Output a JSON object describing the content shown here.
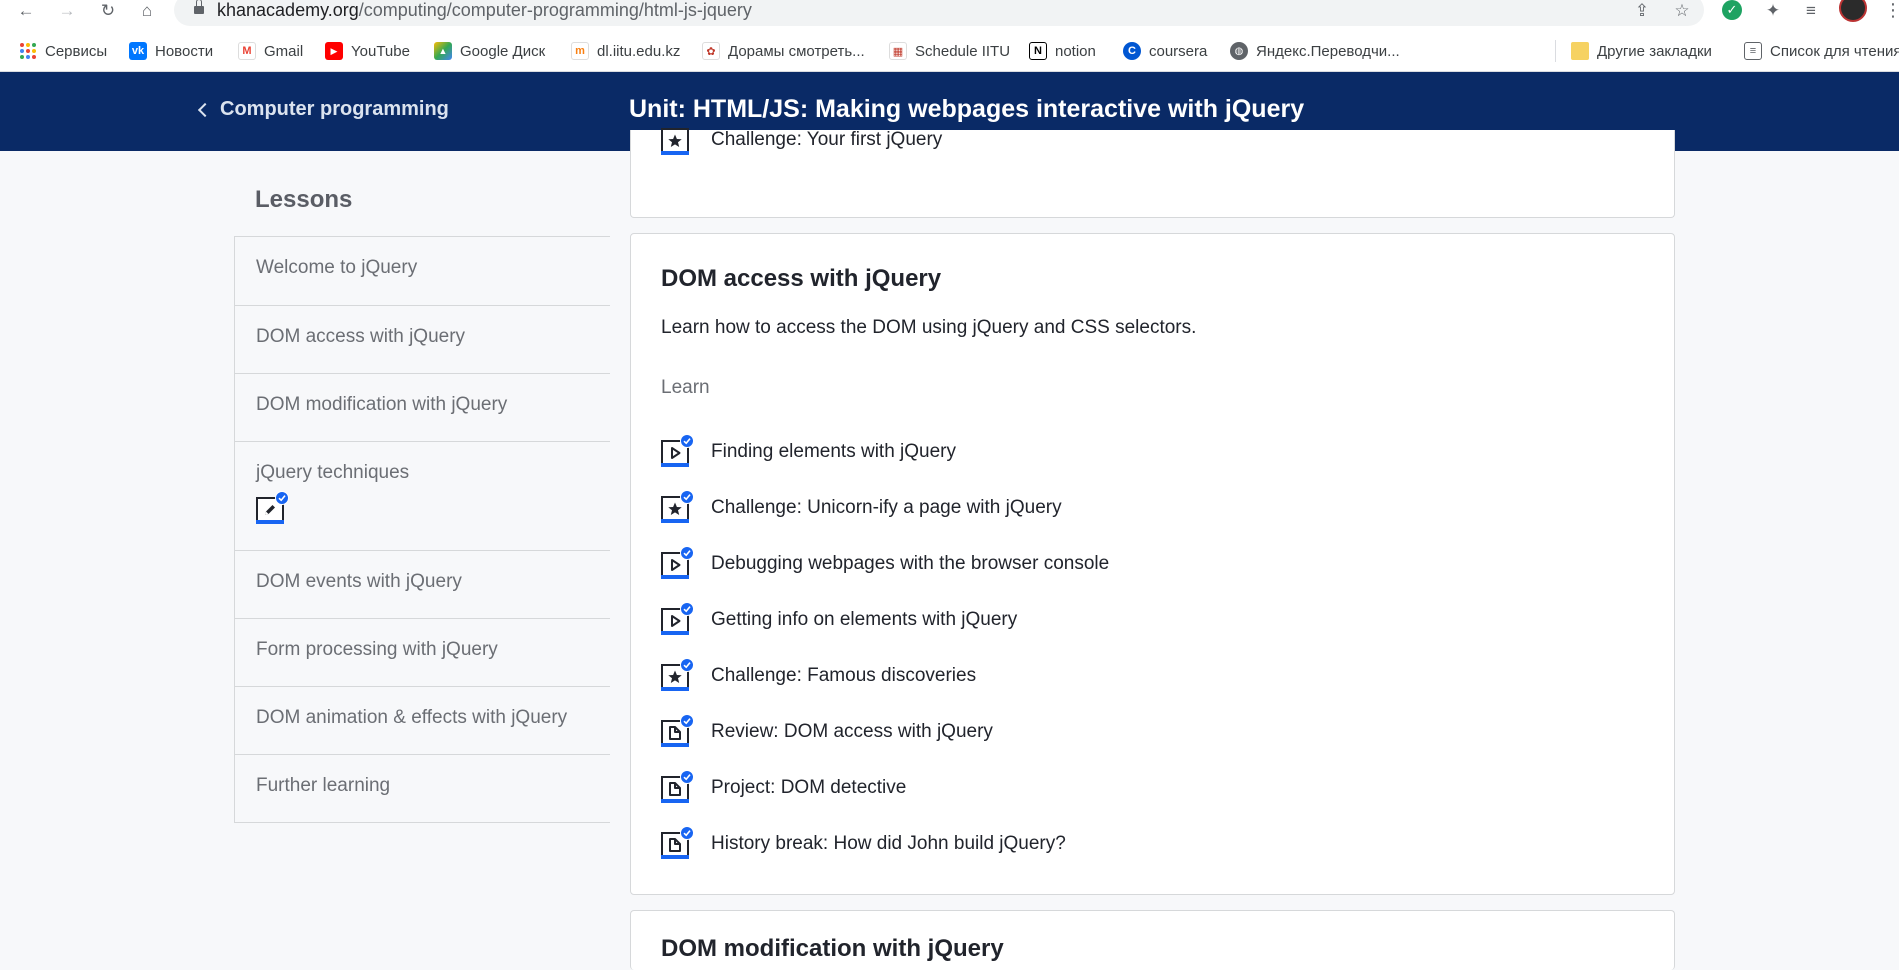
{
  "browser": {
    "url_host": "khanacademy.org",
    "url_path": "/computing/computer-programming/html-js-jquery",
    "bookmarks": [
      {
        "label": "Сервисы",
        "icon": "apps-grid-icon"
      },
      {
        "label": "Новости",
        "icon": "vk-icon"
      },
      {
        "label": "Gmail",
        "icon": "gmail-icon"
      },
      {
        "label": "YouTube",
        "icon": "youtube-icon"
      },
      {
        "label": "Google Диск",
        "icon": "google-drive-icon"
      },
      {
        "label": "dl.iitu.edu.kz",
        "icon": "moodle-icon"
      },
      {
        "label": "Дорамы смотреть...",
        "icon": "dorama-icon"
      },
      {
        "label": "Schedule IITU",
        "icon": "calendar-icon"
      },
      {
        "label": "notion",
        "icon": "notion-icon"
      },
      {
        "label": "coursera",
        "icon": "coursera-icon"
      },
      {
        "label": "Яндекс.Переводчи...",
        "icon": "globe-icon"
      },
      {
        "label": "Другие закладки",
        "icon": "folder-icon"
      },
      {
        "label": "Список для чтения",
        "icon": "reading-list-icon"
      }
    ]
  },
  "header": {
    "back_label": "Computer programming",
    "unit_title": "Unit: HTML/JS: Making webpages interactive with jQuery",
    "bg_color": "#0a2a66"
  },
  "sidebar": {
    "heading": "Lessons",
    "items": [
      {
        "label": "Welcome to jQuery"
      },
      {
        "label": "DOM access with jQuery"
      },
      {
        "label": "DOM modification with jQuery"
      },
      {
        "label": "jQuery techniques",
        "icon": "pencil-exercise-icon"
      },
      {
        "label": "DOM events with jQuery"
      },
      {
        "label": "Form processing with jQuery"
      },
      {
        "label": "DOM animation & effects with jQuery"
      },
      {
        "label": "Further learning"
      }
    ]
  },
  "previous_section": {
    "last_item": {
      "label": "Challenge: Your first jQuery",
      "type": "challenge"
    }
  },
  "section": {
    "title": "DOM access with jQuery",
    "description": "Learn how to access the DOM using jQuery and CSS selectors.",
    "group_label": "Learn",
    "items": [
      {
        "label": "Finding elements with jQuery",
        "type": "video",
        "completed": true
      },
      {
        "label": "Challenge: Unicorn-ify a page with jQuery",
        "type": "challenge",
        "completed": true
      },
      {
        "label": "Debugging webpages with the browser console",
        "type": "video",
        "completed": true
      },
      {
        "label": "Getting info on elements with jQuery",
        "type": "video",
        "completed": true
      },
      {
        "label": "Challenge: Famous discoveries",
        "type": "challenge",
        "completed": true
      },
      {
        "label": "Review: DOM access with jQuery",
        "type": "article",
        "completed": true
      },
      {
        "label": "Project: DOM detective",
        "type": "article",
        "completed": true
      },
      {
        "label": "History break: How did John build jQuery?",
        "type": "article",
        "completed": true
      }
    ]
  },
  "next_section": {
    "title_peek": "DOM modification with jQuery"
  },
  "colors": {
    "accent": "#1865f2",
    "page_bg": "#f7f8fa",
    "text": "#21242c"
  }
}
